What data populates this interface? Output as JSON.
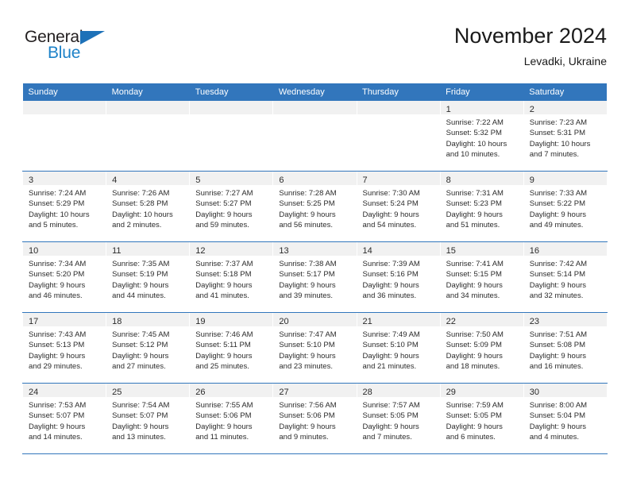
{
  "brand": {
    "name_top": "General",
    "name_bottom": "Blue",
    "triangle_icon": "brand-triangle-icon",
    "color_dark": "#231f20",
    "color_blue": "#1d82c8"
  },
  "header": {
    "title": "November 2024",
    "subtitle": "Levadki, Ukraine"
  },
  "theme": {
    "header_blue": "#3276bc",
    "daynum_band": "#f1f1f1",
    "text": "#2b2b2b",
    "page_background": "#ffffff"
  },
  "weekday_headers": [
    "Sunday",
    "Monday",
    "Tuesday",
    "Wednesday",
    "Thursday",
    "Friday",
    "Saturday"
  ],
  "weeks": [
    [
      {
        "day": "",
        "lines": []
      },
      {
        "day": "",
        "lines": []
      },
      {
        "day": "",
        "lines": []
      },
      {
        "day": "",
        "lines": []
      },
      {
        "day": "",
        "lines": []
      },
      {
        "day": "1",
        "lines": [
          "Sunrise: 7:22 AM",
          "Sunset: 5:32 PM",
          "Daylight: 10 hours",
          "and 10 minutes."
        ]
      },
      {
        "day": "2",
        "lines": [
          "Sunrise: 7:23 AM",
          "Sunset: 5:31 PM",
          "Daylight: 10 hours",
          "and 7 minutes."
        ]
      }
    ],
    [
      {
        "day": "3",
        "lines": [
          "Sunrise: 7:24 AM",
          "Sunset: 5:29 PM",
          "Daylight: 10 hours",
          "and 5 minutes."
        ]
      },
      {
        "day": "4",
        "lines": [
          "Sunrise: 7:26 AM",
          "Sunset: 5:28 PM",
          "Daylight: 10 hours",
          "and 2 minutes."
        ]
      },
      {
        "day": "5",
        "lines": [
          "Sunrise: 7:27 AM",
          "Sunset: 5:27 PM",
          "Daylight: 9 hours",
          "and 59 minutes."
        ]
      },
      {
        "day": "6",
        "lines": [
          "Sunrise: 7:28 AM",
          "Sunset: 5:25 PM",
          "Daylight: 9 hours",
          "and 56 minutes."
        ]
      },
      {
        "day": "7",
        "lines": [
          "Sunrise: 7:30 AM",
          "Sunset: 5:24 PM",
          "Daylight: 9 hours",
          "and 54 minutes."
        ]
      },
      {
        "day": "8",
        "lines": [
          "Sunrise: 7:31 AM",
          "Sunset: 5:23 PM",
          "Daylight: 9 hours",
          "and 51 minutes."
        ]
      },
      {
        "day": "9",
        "lines": [
          "Sunrise: 7:33 AM",
          "Sunset: 5:22 PM",
          "Daylight: 9 hours",
          "and 49 minutes."
        ]
      }
    ],
    [
      {
        "day": "10",
        "lines": [
          "Sunrise: 7:34 AM",
          "Sunset: 5:20 PM",
          "Daylight: 9 hours",
          "and 46 minutes."
        ]
      },
      {
        "day": "11",
        "lines": [
          "Sunrise: 7:35 AM",
          "Sunset: 5:19 PM",
          "Daylight: 9 hours",
          "and 44 minutes."
        ]
      },
      {
        "day": "12",
        "lines": [
          "Sunrise: 7:37 AM",
          "Sunset: 5:18 PM",
          "Daylight: 9 hours",
          "and 41 minutes."
        ]
      },
      {
        "day": "13",
        "lines": [
          "Sunrise: 7:38 AM",
          "Sunset: 5:17 PM",
          "Daylight: 9 hours",
          "and 39 minutes."
        ]
      },
      {
        "day": "14",
        "lines": [
          "Sunrise: 7:39 AM",
          "Sunset: 5:16 PM",
          "Daylight: 9 hours",
          "and 36 minutes."
        ]
      },
      {
        "day": "15",
        "lines": [
          "Sunrise: 7:41 AM",
          "Sunset: 5:15 PM",
          "Daylight: 9 hours",
          "and 34 minutes."
        ]
      },
      {
        "day": "16",
        "lines": [
          "Sunrise: 7:42 AM",
          "Sunset: 5:14 PM",
          "Daylight: 9 hours",
          "and 32 minutes."
        ]
      }
    ],
    [
      {
        "day": "17",
        "lines": [
          "Sunrise: 7:43 AM",
          "Sunset: 5:13 PM",
          "Daylight: 9 hours",
          "and 29 minutes."
        ]
      },
      {
        "day": "18",
        "lines": [
          "Sunrise: 7:45 AM",
          "Sunset: 5:12 PM",
          "Daylight: 9 hours",
          "and 27 minutes."
        ]
      },
      {
        "day": "19",
        "lines": [
          "Sunrise: 7:46 AM",
          "Sunset: 5:11 PM",
          "Daylight: 9 hours",
          "and 25 minutes."
        ]
      },
      {
        "day": "20",
        "lines": [
          "Sunrise: 7:47 AM",
          "Sunset: 5:10 PM",
          "Daylight: 9 hours",
          "and 23 minutes."
        ]
      },
      {
        "day": "21",
        "lines": [
          "Sunrise: 7:49 AM",
          "Sunset: 5:10 PM",
          "Daylight: 9 hours",
          "and 21 minutes."
        ]
      },
      {
        "day": "22",
        "lines": [
          "Sunrise: 7:50 AM",
          "Sunset: 5:09 PM",
          "Daylight: 9 hours",
          "and 18 minutes."
        ]
      },
      {
        "day": "23",
        "lines": [
          "Sunrise: 7:51 AM",
          "Sunset: 5:08 PM",
          "Daylight: 9 hours",
          "and 16 minutes."
        ]
      }
    ],
    [
      {
        "day": "24",
        "lines": [
          "Sunrise: 7:53 AM",
          "Sunset: 5:07 PM",
          "Daylight: 9 hours",
          "and 14 minutes."
        ]
      },
      {
        "day": "25",
        "lines": [
          "Sunrise: 7:54 AM",
          "Sunset: 5:07 PM",
          "Daylight: 9 hours",
          "and 13 minutes."
        ]
      },
      {
        "day": "26",
        "lines": [
          "Sunrise: 7:55 AM",
          "Sunset: 5:06 PM",
          "Daylight: 9 hours",
          "and 11 minutes."
        ]
      },
      {
        "day": "27",
        "lines": [
          "Sunrise: 7:56 AM",
          "Sunset: 5:06 PM",
          "Daylight: 9 hours",
          "and 9 minutes."
        ]
      },
      {
        "day": "28",
        "lines": [
          "Sunrise: 7:57 AM",
          "Sunset: 5:05 PM",
          "Daylight: 9 hours",
          "and 7 minutes."
        ]
      },
      {
        "day": "29",
        "lines": [
          "Sunrise: 7:59 AM",
          "Sunset: 5:05 PM",
          "Daylight: 9 hours",
          "and 6 minutes."
        ]
      },
      {
        "day": "30",
        "lines": [
          "Sunrise: 8:00 AM",
          "Sunset: 5:04 PM",
          "Daylight: 9 hours",
          "and 4 minutes."
        ]
      }
    ]
  ]
}
